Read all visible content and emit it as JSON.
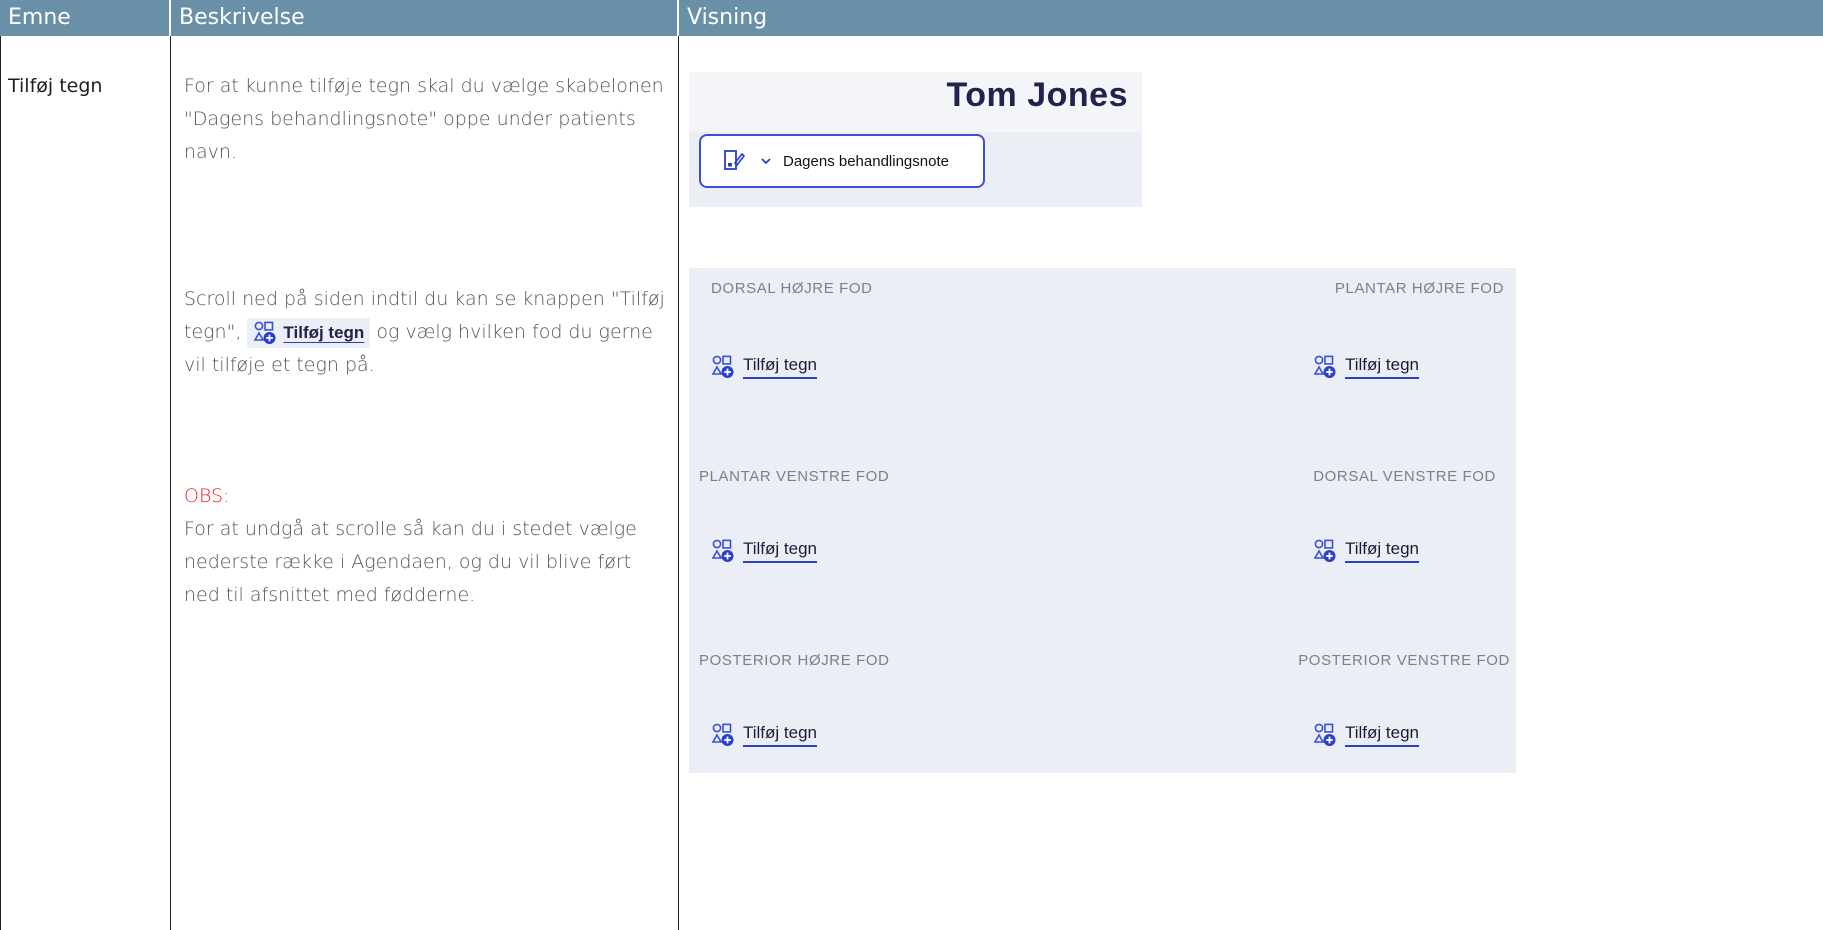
{
  "header": {
    "col1": "Emne",
    "col2": "Beskrivelse",
    "col3": "Visning"
  },
  "row": {
    "topic": "Tilføj tegn",
    "desc1": "For at kunne tilføje tegn skal du vælge skabelonen \"Dagens behandlingsnote\" oppe under patients navn.",
    "desc2_before": "Scroll ned på siden indtil du kan se knappen \"Tilføj tegn\",",
    "desc2_chip": "Tilføj tegn",
    "desc2_after": "og vælg hvilken fod du gerne vil tilføje et tegn på.",
    "obs_label": "OBS:",
    "obs_text": "For at undgå at scrolle så kan du i stedet vælge nederste række i Agendaen, og du vil blive ført ned til afsnittet med fødderne."
  },
  "panel1": {
    "patient_name": "Tom Jones",
    "template_label": "Dagens behandlingsnote"
  },
  "panel2": {
    "sections": [
      {
        "title": "DORSAL HØJRE FOD",
        "button": "Tilføj tegn"
      },
      {
        "title": "PLANTAR HØJRE FOD",
        "button": "Tilføj tegn"
      },
      {
        "title": "PLANTAR VENSTRE FOD",
        "button": "Tilføj tegn"
      },
      {
        "title": "DORSAL VENSTRE FOD",
        "button": "Tilføj tegn"
      },
      {
        "title": "POSTERIOR HØJRE FOD",
        "button": "Tilføj tegn"
      },
      {
        "title": "POSTERIOR VENSTRE FOD",
        "button": "Tilføj tegn"
      }
    ]
  },
  "icons": {
    "shape_add": "shapes-add-icon",
    "document": "document-edit-icon",
    "chevron": "chevron-down-icon"
  },
  "colors": {
    "header_bg": "#6a90a8",
    "accent": "#3a50d4",
    "obs": "#ee2222",
    "panel_bg": "#eceef5",
    "name": "#23224f"
  }
}
